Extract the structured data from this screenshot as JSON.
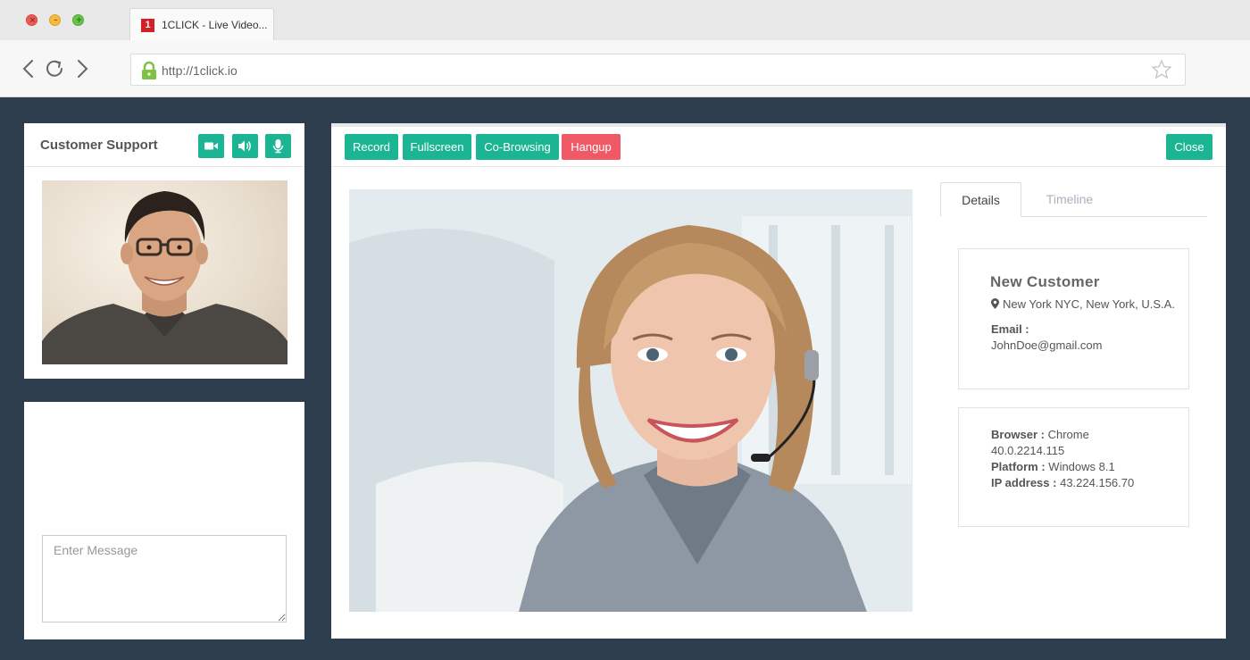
{
  "browser": {
    "tab_title": "1CLICK - Live Video...",
    "favicon_text": "1",
    "url": "http://1click.io"
  },
  "support_panel": {
    "title": "Customer Support",
    "controls": [
      "video-camera-icon",
      "speaker-icon",
      "microphone-icon"
    ]
  },
  "message_panel": {
    "placeholder": "Enter Message"
  },
  "call_toolbar": {
    "record": "Record",
    "fullscreen": "Fullscreen",
    "cobrowsing": "Co-Browsing",
    "hangup": "Hangup",
    "close": "Close"
  },
  "tabs": {
    "details": "Details",
    "timeline": "Timeline"
  },
  "customer": {
    "name": "New Customer",
    "location": "New York NYC, New York, U.S.A.",
    "email_label": "Email :",
    "email": "JohnDoe@gmail.com"
  },
  "system": {
    "browser_label": "Browser :",
    "browser_value": "Chrome",
    "browser_version": "40.0.2214.115",
    "platform_label": "Platform :",
    "platform_value": "Windows 8.1",
    "ip_label": "IP address :",
    "ip_value": "43.224.156.70"
  },
  "colors": {
    "accent_green": "#1bb594",
    "hangup_red": "#f05a66",
    "background": "#2f3e4e"
  }
}
